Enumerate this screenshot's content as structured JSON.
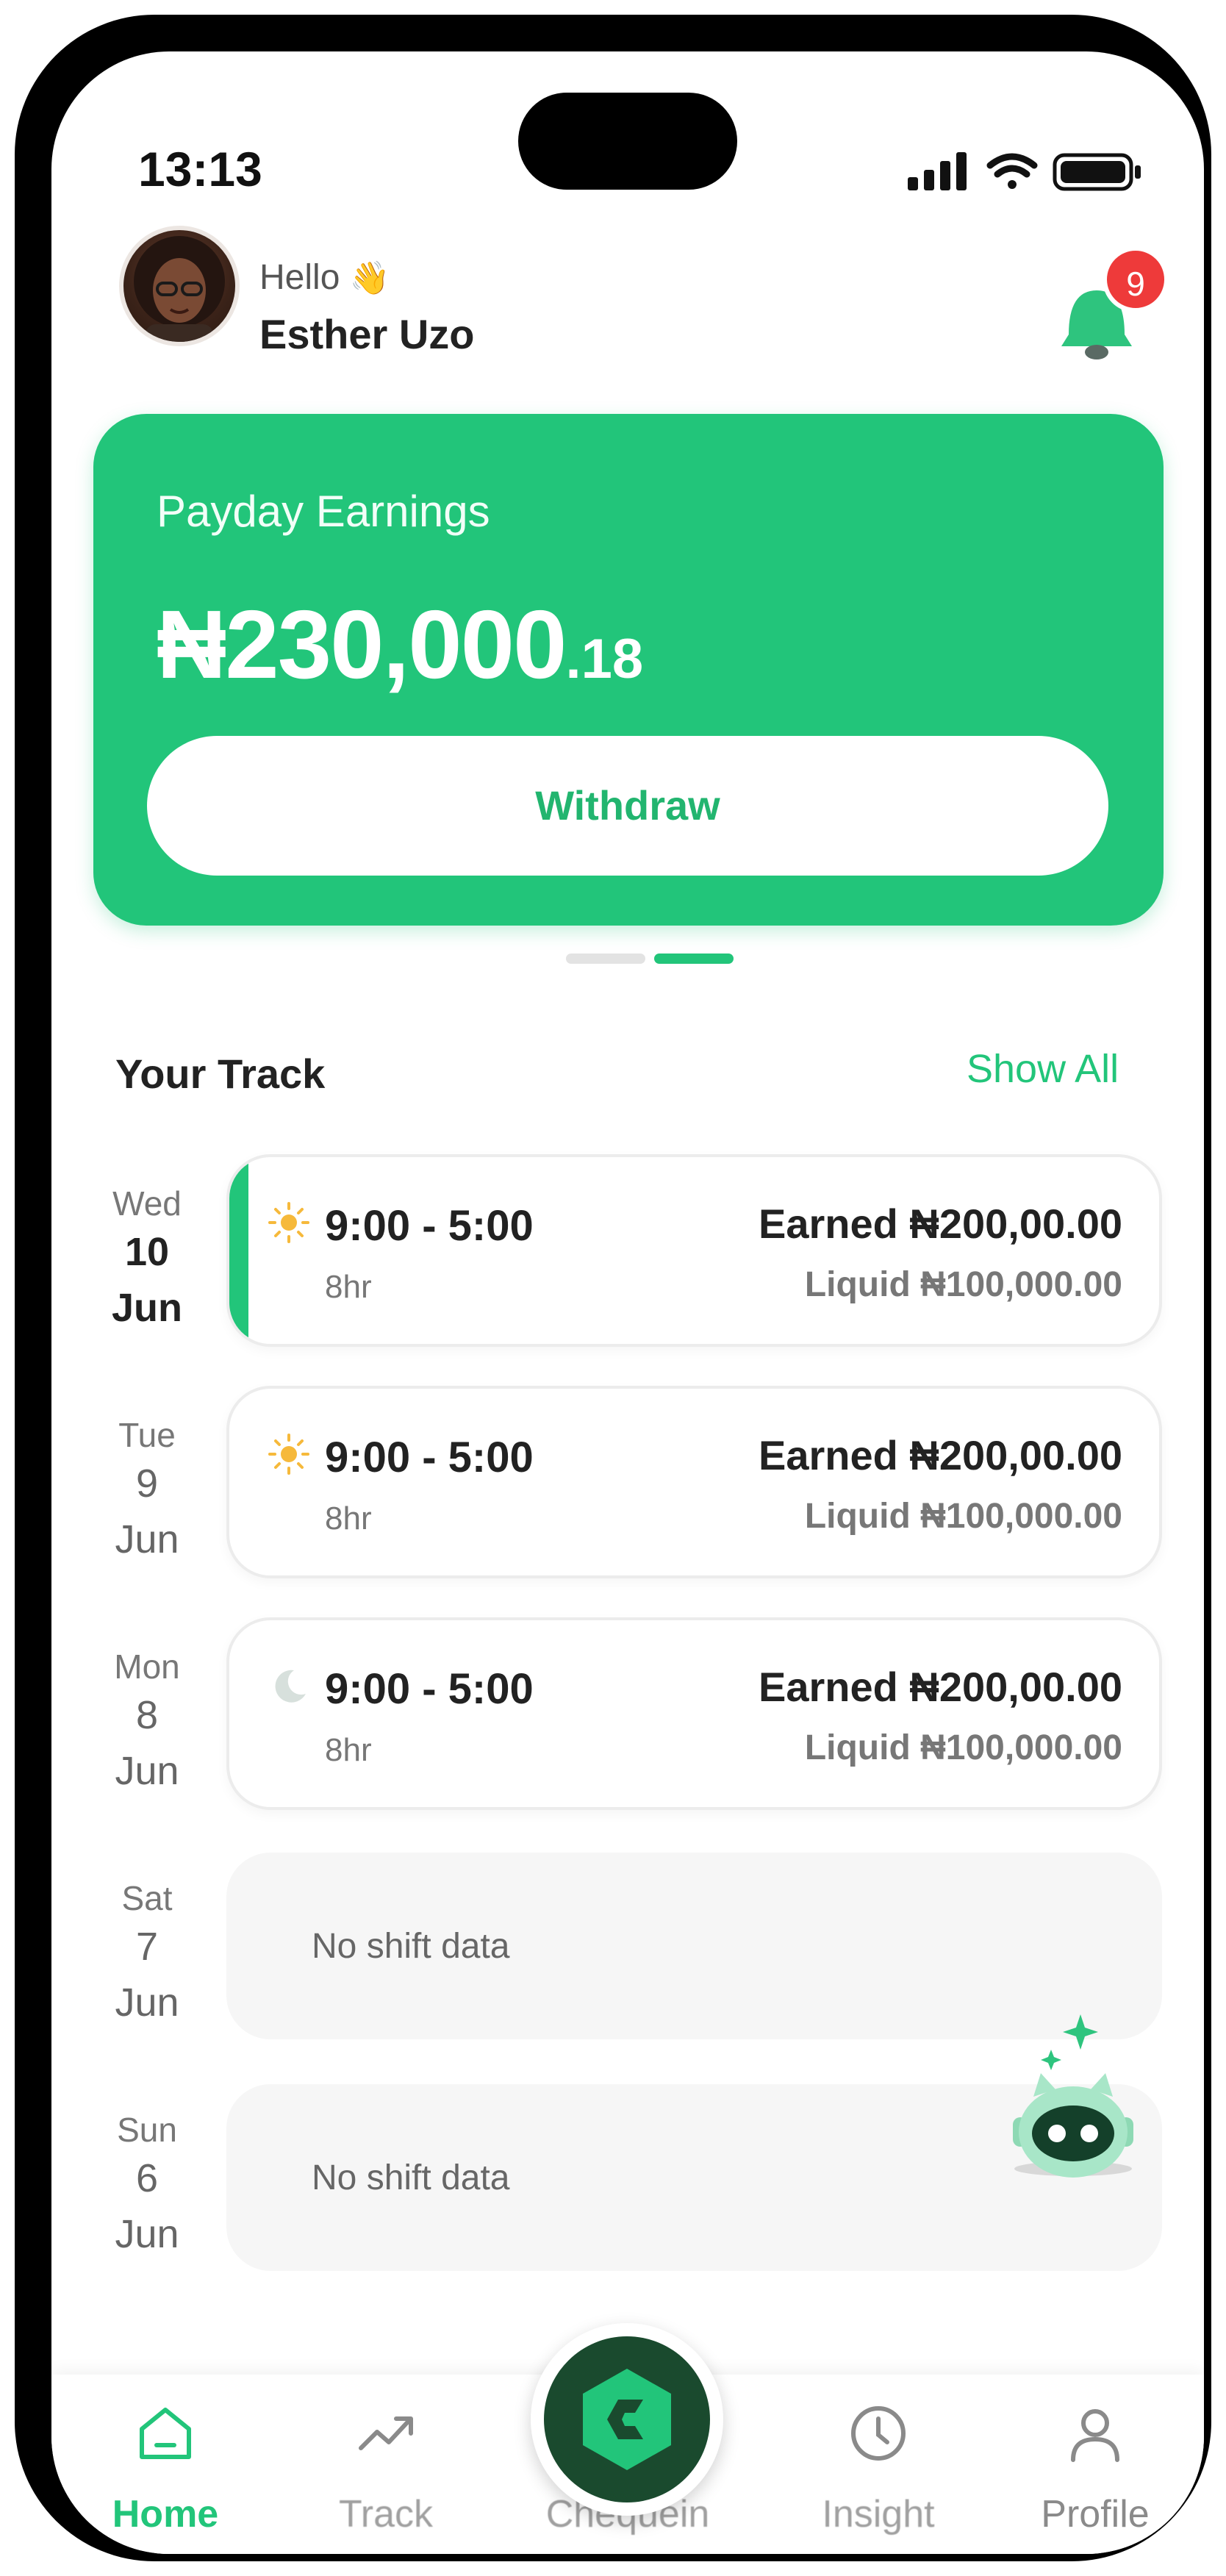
{
  "status_bar": {
    "time": "13:13"
  },
  "header": {
    "greeting": "Hello",
    "greeting_emoji": "👋",
    "user_name": "Esther Uzo",
    "notification_count": "9"
  },
  "earnings_card": {
    "label": "Payday Earnings",
    "amount_main": "₦230,000",
    "amount_cents": ".18",
    "withdraw_label": "Withdraw",
    "carousel_pages": 2,
    "carousel_active": 2
  },
  "track": {
    "title": "Your Track",
    "show_all": "Show All",
    "days": [
      {
        "weekday": "Wed",
        "day": "10",
        "month": "Jun",
        "icon": "sun-icon",
        "time": "9:00 - 5:00",
        "duration": "8hr",
        "earned": "Earned ₦200,00.00",
        "liquid": "Liquid ₦100,000.00"
      },
      {
        "weekday": "Tue",
        "day": "9",
        "month": "Jun",
        "icon": "sun-icon",
        "time": "9:00 - 5:00",
        "duration": "8hr",
        "earned": "Earned ₦200,00.00",
        "liquid": "Liquid ₦100,000.00"
      },
      {
        "weekday": "Mon",
        "day": "8",
        "month": "Jun",
        "icon": "moon-icon",
        "time": "9:00 - 5:00",
        "duration": "8hr",
        "earned": "Earned ₦200,00.00",
        "liquid": "Liquid ₦100,000.00"
      },
      {
        "weekday": "Sat",
        "day": "7",
        "month": "Jun",
        "empty_text": "No shift data"
      },
      {
        "weekday": "Sun",
        "day": "6",
        "month": "Jun",
        "empty_text": "No shift data"
      }
    ]
  },
  "tabbar": {
    "items": [
      {
        "label": "Home",
        "icon": "home-icon"
      },
      {
        "label": "Track",
        "icon": "trend-icon"
      },
      {
        "label": "Chequein",
        "icon": "chequein-logo-icon"
      },
      {
        "label": "Insight",
        "icon": "clock-icon"
      },
      {
        "label": "Profile",
        "icon": "user-icon"
      }
    ]
  },
  "colors": {
    "brand_green": "#22c57a",
    "badge_red": "#ee3a3a",
    "dark_green": "#1a4a2e"
  }
}
